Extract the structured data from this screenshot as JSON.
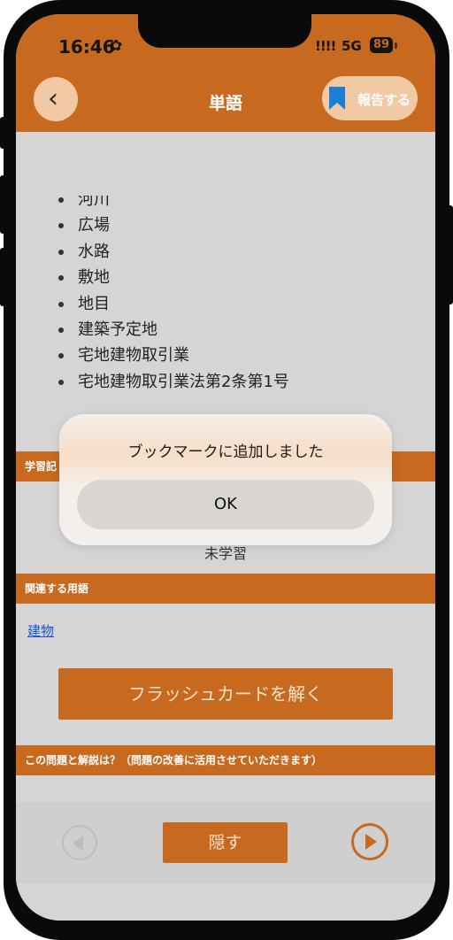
{
  "status_bar": {
    "time": "16:46",
    "signal": "!!!!",
    "network": "5G",
    "battery": "89"
  },
  "header": {
    "title": "単語",
    "back_icon": "chevron-left-icon",
    "report_label": "報告する",
    "bookmark_color": "#1a7fd4"
  },
  "word_list": [
    "河川",
    "広場",
    "水路",
    "敷地",
    "地目",
    "建築予定地",
    "宅地建物取引業",
    "宅地建物取引業法第2条第1号"
  ],
  "sections": {
    "study_record": "学習記",
    "related_terms": "関連する用語",
    "feedback": "この問題と解説は？（問題の改善に活用させていただきます）"
  },
  "study_status": "未学習",
  "related_term_link": "建物",
  "flashcard_button": "フラッシュカードを解く",
  "bottom_nav": {
    "hide_label": "隠す"
  },
  "dialog": {
    "message": "ブックマークに追加しました",
    "ok_label": "OK"
  },
  "colors": {
    "brand": "#c76a1f",
    "overlay": "#d5d5d5"
  }
}
